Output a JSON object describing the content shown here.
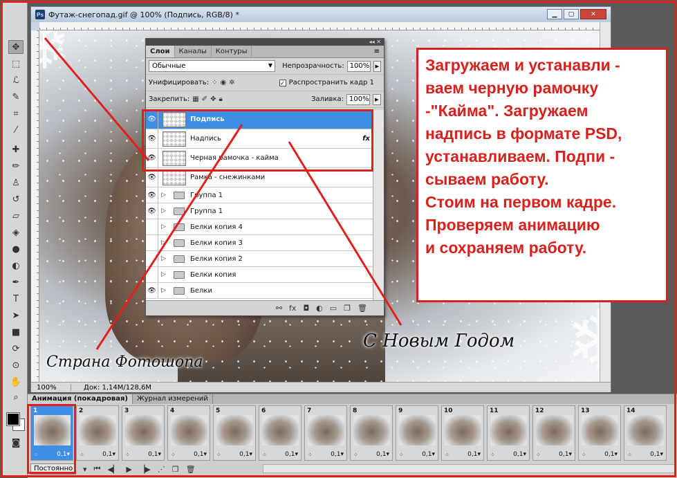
{
  "window": {
    "app_icon": "Ps",
    "title": "Футаж-снегопад.gif @ 100% (Подпись, RGB/8) *",
    "zoom": "100%",
    "doc_info": "Док: 1,14M/128,6M"
  },
  "layers_panel": {
    "tabs": [
      "Слои",
      "Каналы",
      "Контуры"
    ],
    "blend_mode": "Обычные",
    "opacity_label": "Непрозрачность:",
    "opacity_value": "100%",
    "unify_label": "Унифицировать:",
    "propagate_label": "Распространить кадр 1",
    "lock_label": "Закрепить:",
    "fill_label": "Заливка:",
    "fill_value": "100%",
    "layers": [
      {
        "name": "Подпись",
        "visible": true,
        "type": "layer",
        "selected": true
      },
      {
        "name": "Надпись",
        "visible": true,
        "type": "layer",
        "fx": "fx"
      },
      {
        "name": "Черная рамочка - кайма",
        "visible": true,
        "type": "layer"
      },
      {
        "name": "Рамка - снежинками",
        "visible": true,
        "type": "layer"
      },
      {
        "name": "Группа 1",
        "visible": true,
        "type": "group"
      },
      {
        "name": "Группа 1",
        "visible": true,
        "type": "group"
      },
      {
        "name": "Белки копия 4",
        "visible": false,
        "type": "group"
      },
      {
        "name": "Белки копия 3",
        "visible": false,
        "type": "group"
      },
      {
        "name": "Белки копия 2",
        "visible": false,
        "type": "group"
      },
      {
        "name": "Белки копия",
        "visible": false,
        "type": "group"
      },
      {
        "name": "Белки",
        "visible": true,
        "type": "group"
      }
    ]
  },
  "canvas": {
    "signature": "Страна Фотошопа",
    "greeting": "С Новым Годом"
  },
  "note": {
    "lines": [
      "Загружаем и устанавли -",
      "ваем черную рамочку",
      "-\"Кайма\". Загружаем",
      "надпись в формате PSD,",
      "устанавливаем. Подпи -",
      "сываем работу.",
      "Стоим на первом кадре.",
      "Проверяем анимацию",
      "и сохраняем работу."
    ]
  },
  "animation_panel": {
    "tabs": [
      "Анимация (покадровая)",
      "Журнал измерений"
    ],
    "frames": [
      {
        "n": "1",
        "t": "0,1"
      },
      {
        "n": "2",
        "t": "0,1"
      },
      {
        "n": "3",
        "t": "0,1"
      },
      {
        "n": "4",
        "t": "0,1"
      },
      {
        "n": "5",
        "t": "0,1"
      },
      {
        "n": "6",
        "t": "0,1"
      },
      {
        "n": "7",
        "t": "0,1"
      },
      {
        "n": "8",
        "t": "0,1"
      },
      {
        "n": "9",
        "t": "0,1"
      },
      {
        "n": "10",
        "t": "0,1"
      },
      {
        "n": "11",
        "t": "0,1"
      },
      {
        "n": "12",
        "t": "0,1"
      },
      {
        "n": "13",
        "t": "0,1"
      },
      {
        "n": "14",
        "t": "0,1"
      }
    ],
    "loop": "Постоянно"
  },
  "colors": {
    "annotation_red": "#e0201c",
    "selection_blue": "#3d8fe6"
  }
}
